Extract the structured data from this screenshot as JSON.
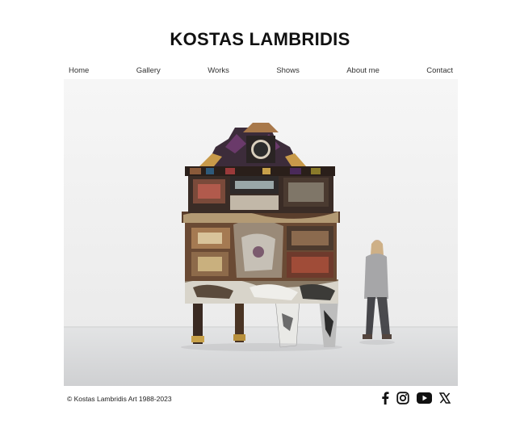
{
  "header": {
    "title": "KOSTAS LAMBRIDIS"
  },
  "nav": {
    "items": [
      {
        "label": "Home"
      },
      {
        "label": "Gallery"
      },
      {
        "label": "Works"
      },
      {
        "label": "Shows"
      },
      {
        "label": "About me"
      },
      {
        "label": "Contact"
      }
    ]
  },
  "hero": {
    "image": "installation-sculpture-photo"
  },
  "footer": {
    "copyright": "© Kostas Lambridis Art 1988-2023",
    "social_icons": [
      "facebook-icon",
      "instagram-icon",
      "youtube-icon",
      "x-icon"
    ]
  },
  "colors": {
    "text": "#111111",
    "background": "#ffffff",
    "gallery_wall": "#f0f0f0",
    "gallery_floor": "#d8d9da"
  }
}
